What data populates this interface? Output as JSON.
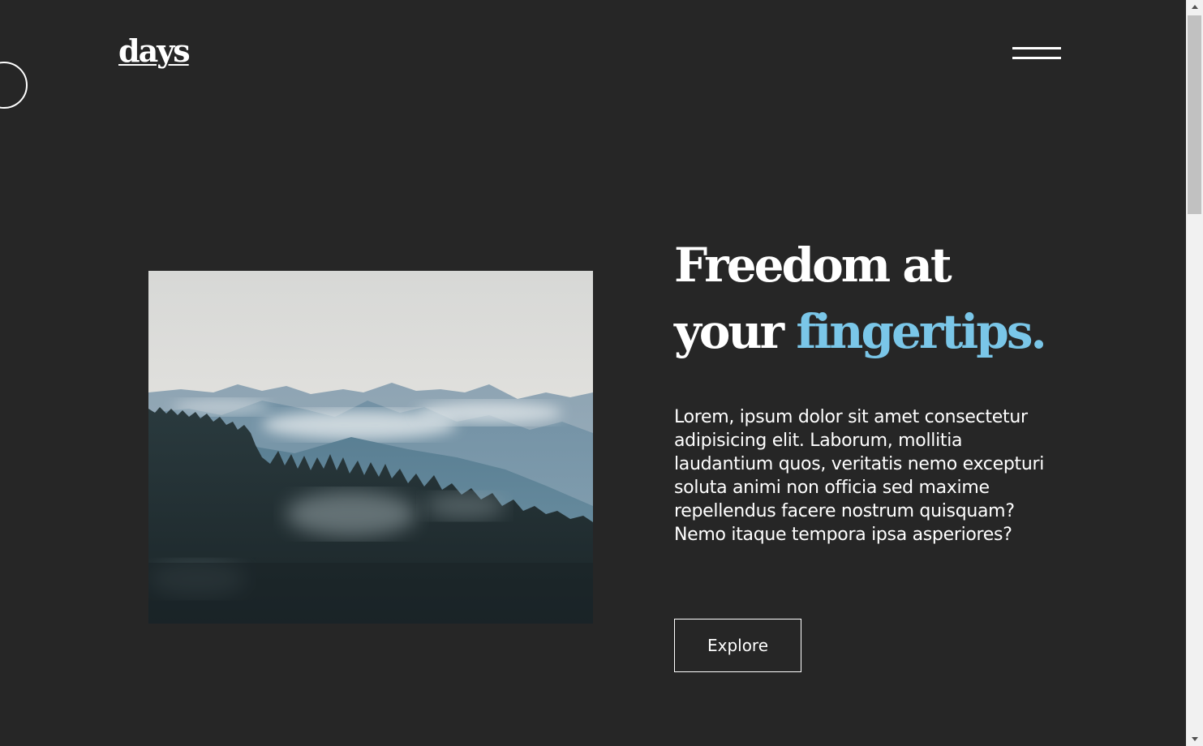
{
  "header": {
    "logo_text": "days",
    "menu_icon": "hamburger-menu-icon"
  },
  "hero": {
    "image_description": "misty-mountain-forest-photo",
    "headline_line1": "Freedom at",
    "headline_line2_plain": "your ",
    "headline_line2_accent": "fingertips.",
    "body": "Lorem, ipsum dolor sit amet consectetur adipisicing elit. Laborum, mollitia laudantium quos, veritatis nemo excepturi soluta animi non officia sed maxime repellendus facere nostrum quisquam? Nemo itaque tempora ipsa asperiores?",
    "cta_label": "Explore"
  },
  "colors": {
    "background": "#262626",
    "text": "#ffffff",
    "accent": "#7ac6e8"
  },
  "scrollbar": {
    "up_icon": "scroll-up-arrow-icon",
    "down_icon": "scroll-down-arrow-icon"
  }
}
